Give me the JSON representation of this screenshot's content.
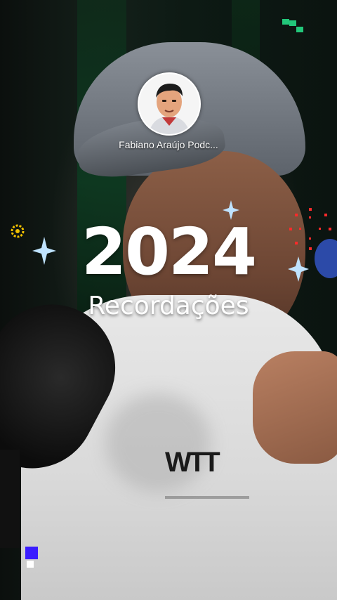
{
  "channel": {
    "name": "Fabiano Araújo Podc...",
    "avatar_icon": "cartoon-portrait-avatar"
  },
  "overlay": {
    "year": "2024",
    "subtitle": "Recordações"
  },
  "decor": {
    "sparkle_color": "#bfe3ff",
    "accent_green": "#22c77a",
    "accent_blue": "#3a1cff",
    "accent_red": "#ff2a2a",
    "accent_yellow": "#f2c200"
  }
}
